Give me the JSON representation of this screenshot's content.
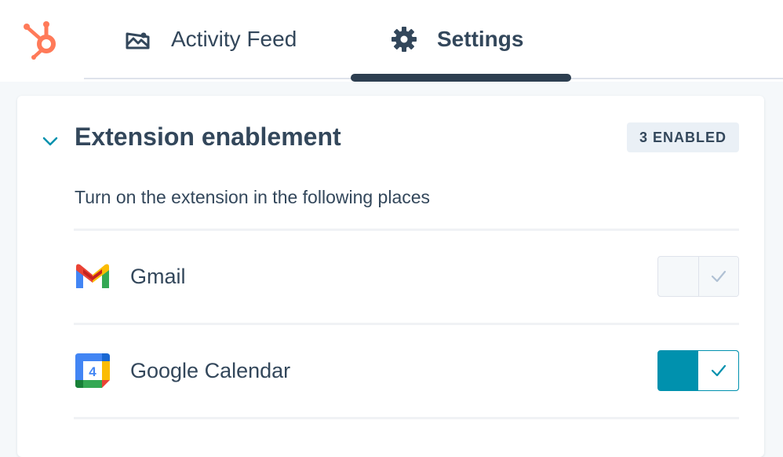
{
  "nav": {
    "logo_icon": "hubspot-sprocket-icon",
    "tabs": [
      {
        "label": "Activity Feed",
        "icon": "activity-feed-icon",
        "active": false
      },
      {
        "label": "Settings",
        "icon": "gear-icon",
        "active": true
      }
    ]
  },
  "section": {
    "title": "Extension enablement",
    "badge": "3 ENABLED",
    "expanded": true,
    "description": "Turn on the extension in the following places"
  },
  "places": [
    {
      "label": "Gmail",
      "icon": "gmail-icon",
      "enabled": false
    },
    {
      "label": "Google Calendar",
      "icon": "google-calendar-icon",
      "calendar_day": "4",
      "enabled": true
    }
  ],
  "colors": {
    "brand_orange": "#ff7a59",
    "text": "#33475b",
    "toggle_on": "#0091ae",
    "tab_indicator": "#2d3e50"
  }
}
